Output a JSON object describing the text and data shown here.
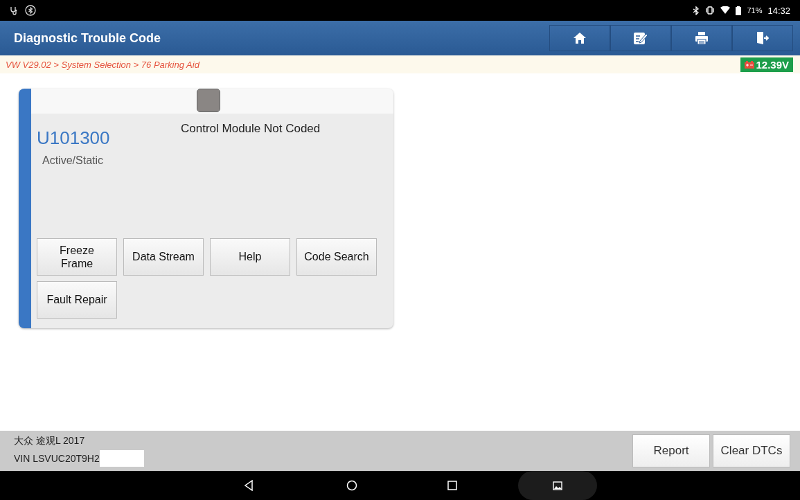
{
  "status_bar": {
    "battery": "71%",
    "time": "14:32"
  },
  "header": {
    "title": "Diagnostic Trouble Code"
  },
  "breadcrumb": "VW V29.02 > System Selection > 76 Parking Aid",
  "voltage": "12.39V",
  "dtcs": [
    {
      "checked": false,
      "code": "U101300",
      "status": "Active/Static",
      "description": "Control Module Not Coded",
      "buttons": [
        "Freeze\nFrame",
        "Data Stream",
        "Help",
        "Code Search",
        "Fault Repair"
      ]
    }
  ],
  "footer": {
    "vehicle": "大众 途观L 2017",
    "vin": "VIN LSVUC20T9H2",
    "buttons": [
      "Report",
      "Clear DTCs"
    ]
  }
}
